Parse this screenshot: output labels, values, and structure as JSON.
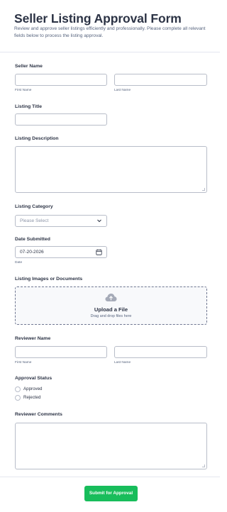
{
  "form": {
    "title": "Seller Listing Approval Form",
    "description": "Review and approve seller listings efficiently and professionally. Please complete all relevant fields below to process the listing approval."
  },
  "seller_name": {
    "label": "Seller Name",
    "first_sublabel": "First Name",
    "last_sublabel": "Last Name",
    "first_value": "",
    "last_value": ""
  },
  "listing_title": {
    "label": "Listing Title",
    "value": ""
  },
  "listing_description": {
    "label": "Listing Description",
    "value": ""
  },
  "listing_category": {
    "label": "Listing Category",
    "selected": "Please Select"
  },
  "date_submitted": {
    "label": "Date Submitted",
    "value": "07-20-2026",
    "sublabel": "Date"
  },
  "upload": {
    "label": "Listing Images or Documents",
    "title": "Upload a File",
    "subtitle": "Drag and drop files here"
  },
  "reviewer_name": {
    "label": "Reviewer Name",
    "first_sublabel": "First Name",
    "last_sublabel": "Last Name",
    "first_value": "",
    "last_value": ""
  },
  "approval_status": {
    "label": "Approval Status",
    "options": [
      "Approved",
      "Rejected"
    ]
  },
  "reviewer_comments": {
    "label": "Reviewer Comments",
    "value": ""
  },
  "submit": {
    "label": "Submit for Approval"
  },
  "colors": {
    "accent": "#18bd5b",
    "text": "#2c3345",
    "muted": "#57647e",
    "border": "#b8bdc9"
  },
  "icons": {
    "upload": "cloud-upload-icon",
    "calendar": "calendar-icon",
    "select": "chevron-down-icon"
  }
}
